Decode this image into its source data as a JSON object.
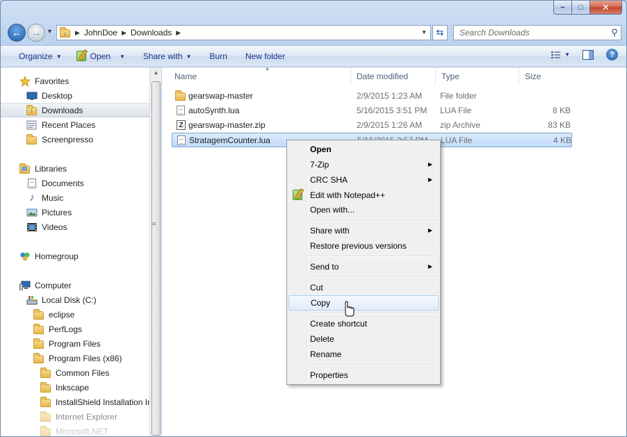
{
  "window": {
    "caption": {
      "minimize": "−",
      "maximize": "□",
      "close": "✕"
    }
  },
  "address": {
    "crumbs": [
      "JohnDoe",
      "Downloads"
    ],
    "search_placeholder": "Search Downloads"
  },
  "toolbar": {
    "organize": "Organize",
    "open": "Open",
    "share_with": "Share with",
    "burn": "Burn",
    "new_folder": "New folder"
  },
  "nav": {
    "favorites": "Favorites",
    "desktop": "Desktop",
    "downloads": "Downloads",
    "recent_places": "Recent Places",
    "screenpresso": "Screenpresso",
    "libraries": "Libraries",
    "documents": "Documents",
    "music": "Music",
    "pictures": "Pictures",
    "videos": "Videos",
    "homegroup": "Homegroup",
    "computer": "Computer",
    "local_disk": "Local Disk (C:)",
    "eclipse": "eclipse",
    "perflogs": "PerfLogs",
    "program_files": "Program Files",
    "program_files_x86": "Program Files (x86)",
    "common_files": "Common Files",
    "inkscape": "Inkscape",
    "installshield": "InstallShield Installation In",
    "internet_explorer": "Internet Explorer",
    "microsoft_net": "Microsoft.NET"
  },
  "columns": {
    "name": "Name",
    "date": "Date modified",
    "type": "Type",
    "size": "Size"
  },
  "files": [
    {
      "name": "gearswap-master",
      "date": "2/9/2015 1:23 AM",
      "type": "File folder",
      "size": ""
    },
    {
      "name": "autoSynth.lua",
      "date": "5/16/2015 3:51 PM",
      "type": "LUA File",
      "size": "8 KB"
    },
    {
      "name": "gearswap-master.zip",
      "date": "2/9/2015 1:26 AM",
      "type": "zip Archive",
      "size": "83 KB"
    },
    {
      "name": "StratagemCounter.lua",
      "date": "5/16/2015 2:57 PM",
      "type": "LUA File",
      "size": "4 KB"
    }
  ],
  "context_menu": {
    "open": "Open",
    "seven_zip": "7-Zip",
    "crc_sha": "CRC SHA",
    "edit_notepad": "Edit with Notepad++",
    "open_with": "Open with...",
    "share_with": "Share with",
    "restore": "Restore previous versions",
    "send_to": "Send to",
    "cut": "Cut",
    "copy": "Copy",
    "create_shortcut": "Create shortcut",
    "delete": "Delete",
    "rename": "Rename",
    "properties": "Properties"
  }
}
